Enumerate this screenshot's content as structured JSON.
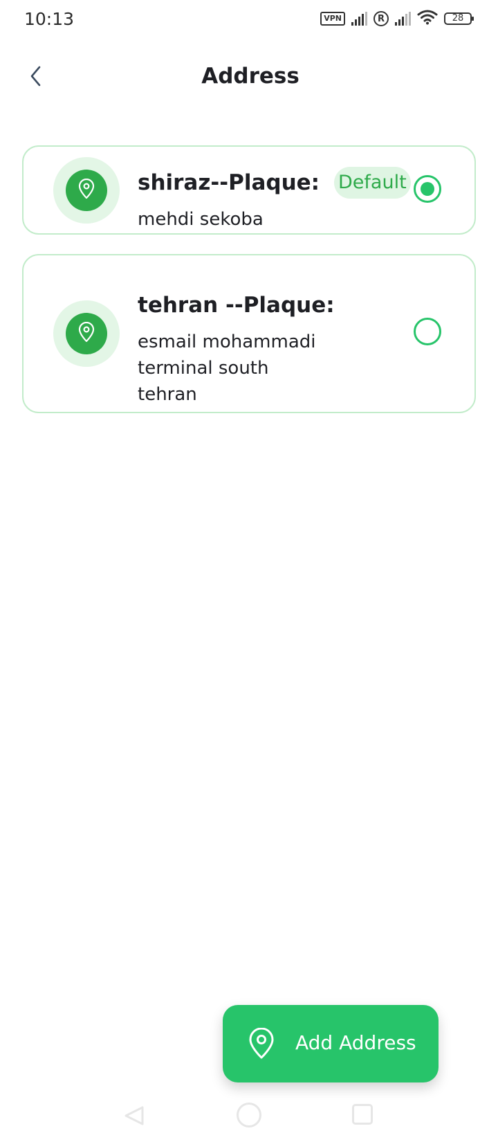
{
  "status_bar": {
    "time": "10:13",
    "vpn_label": "VPN",
    "roaming_label": "R",
    "battery_level": "28",
    "icons": [
      "vpn-icon",
      "signal-icon",
      "roaming-icon",
      "signal-icon",
      "wifi-icon",
      "battery-icon"
    ]
  },
  "header": {
    "title": "Address",
    "back_icon": "chevron-left-icon"
  },
  "addresses": [
    {
      "title": "shiraz--Plaque:",
      "lines": [
        "mehdi sekoba"
      ],
      "is_default": true,
      "default_label": "Default",
      "selected": true,
      "icon": "location-pin-icon"
    },
    {
      "title": "tehran --Plaque:",
      "lines": [
        "esmail mohammadi",
        "terminal south",
        "tehran"
      ],
      "is_default": false,
      "selected": false,
      "icon": "location-pin-icon"
    }
  ],
  "add_button": {
    "label": "Add Address",
    "icon": "location-pin-icon"
  },
  "colors": {
    "accent": "#27c46a",
    "pin_bg": "#2eaa4a",
    "pin_halo": "#e3f6e6",
    "card_border": "#c2ecca",
    "badge_bg": "#dff5e3",
    "text": "#1e1f24"
  }
}
